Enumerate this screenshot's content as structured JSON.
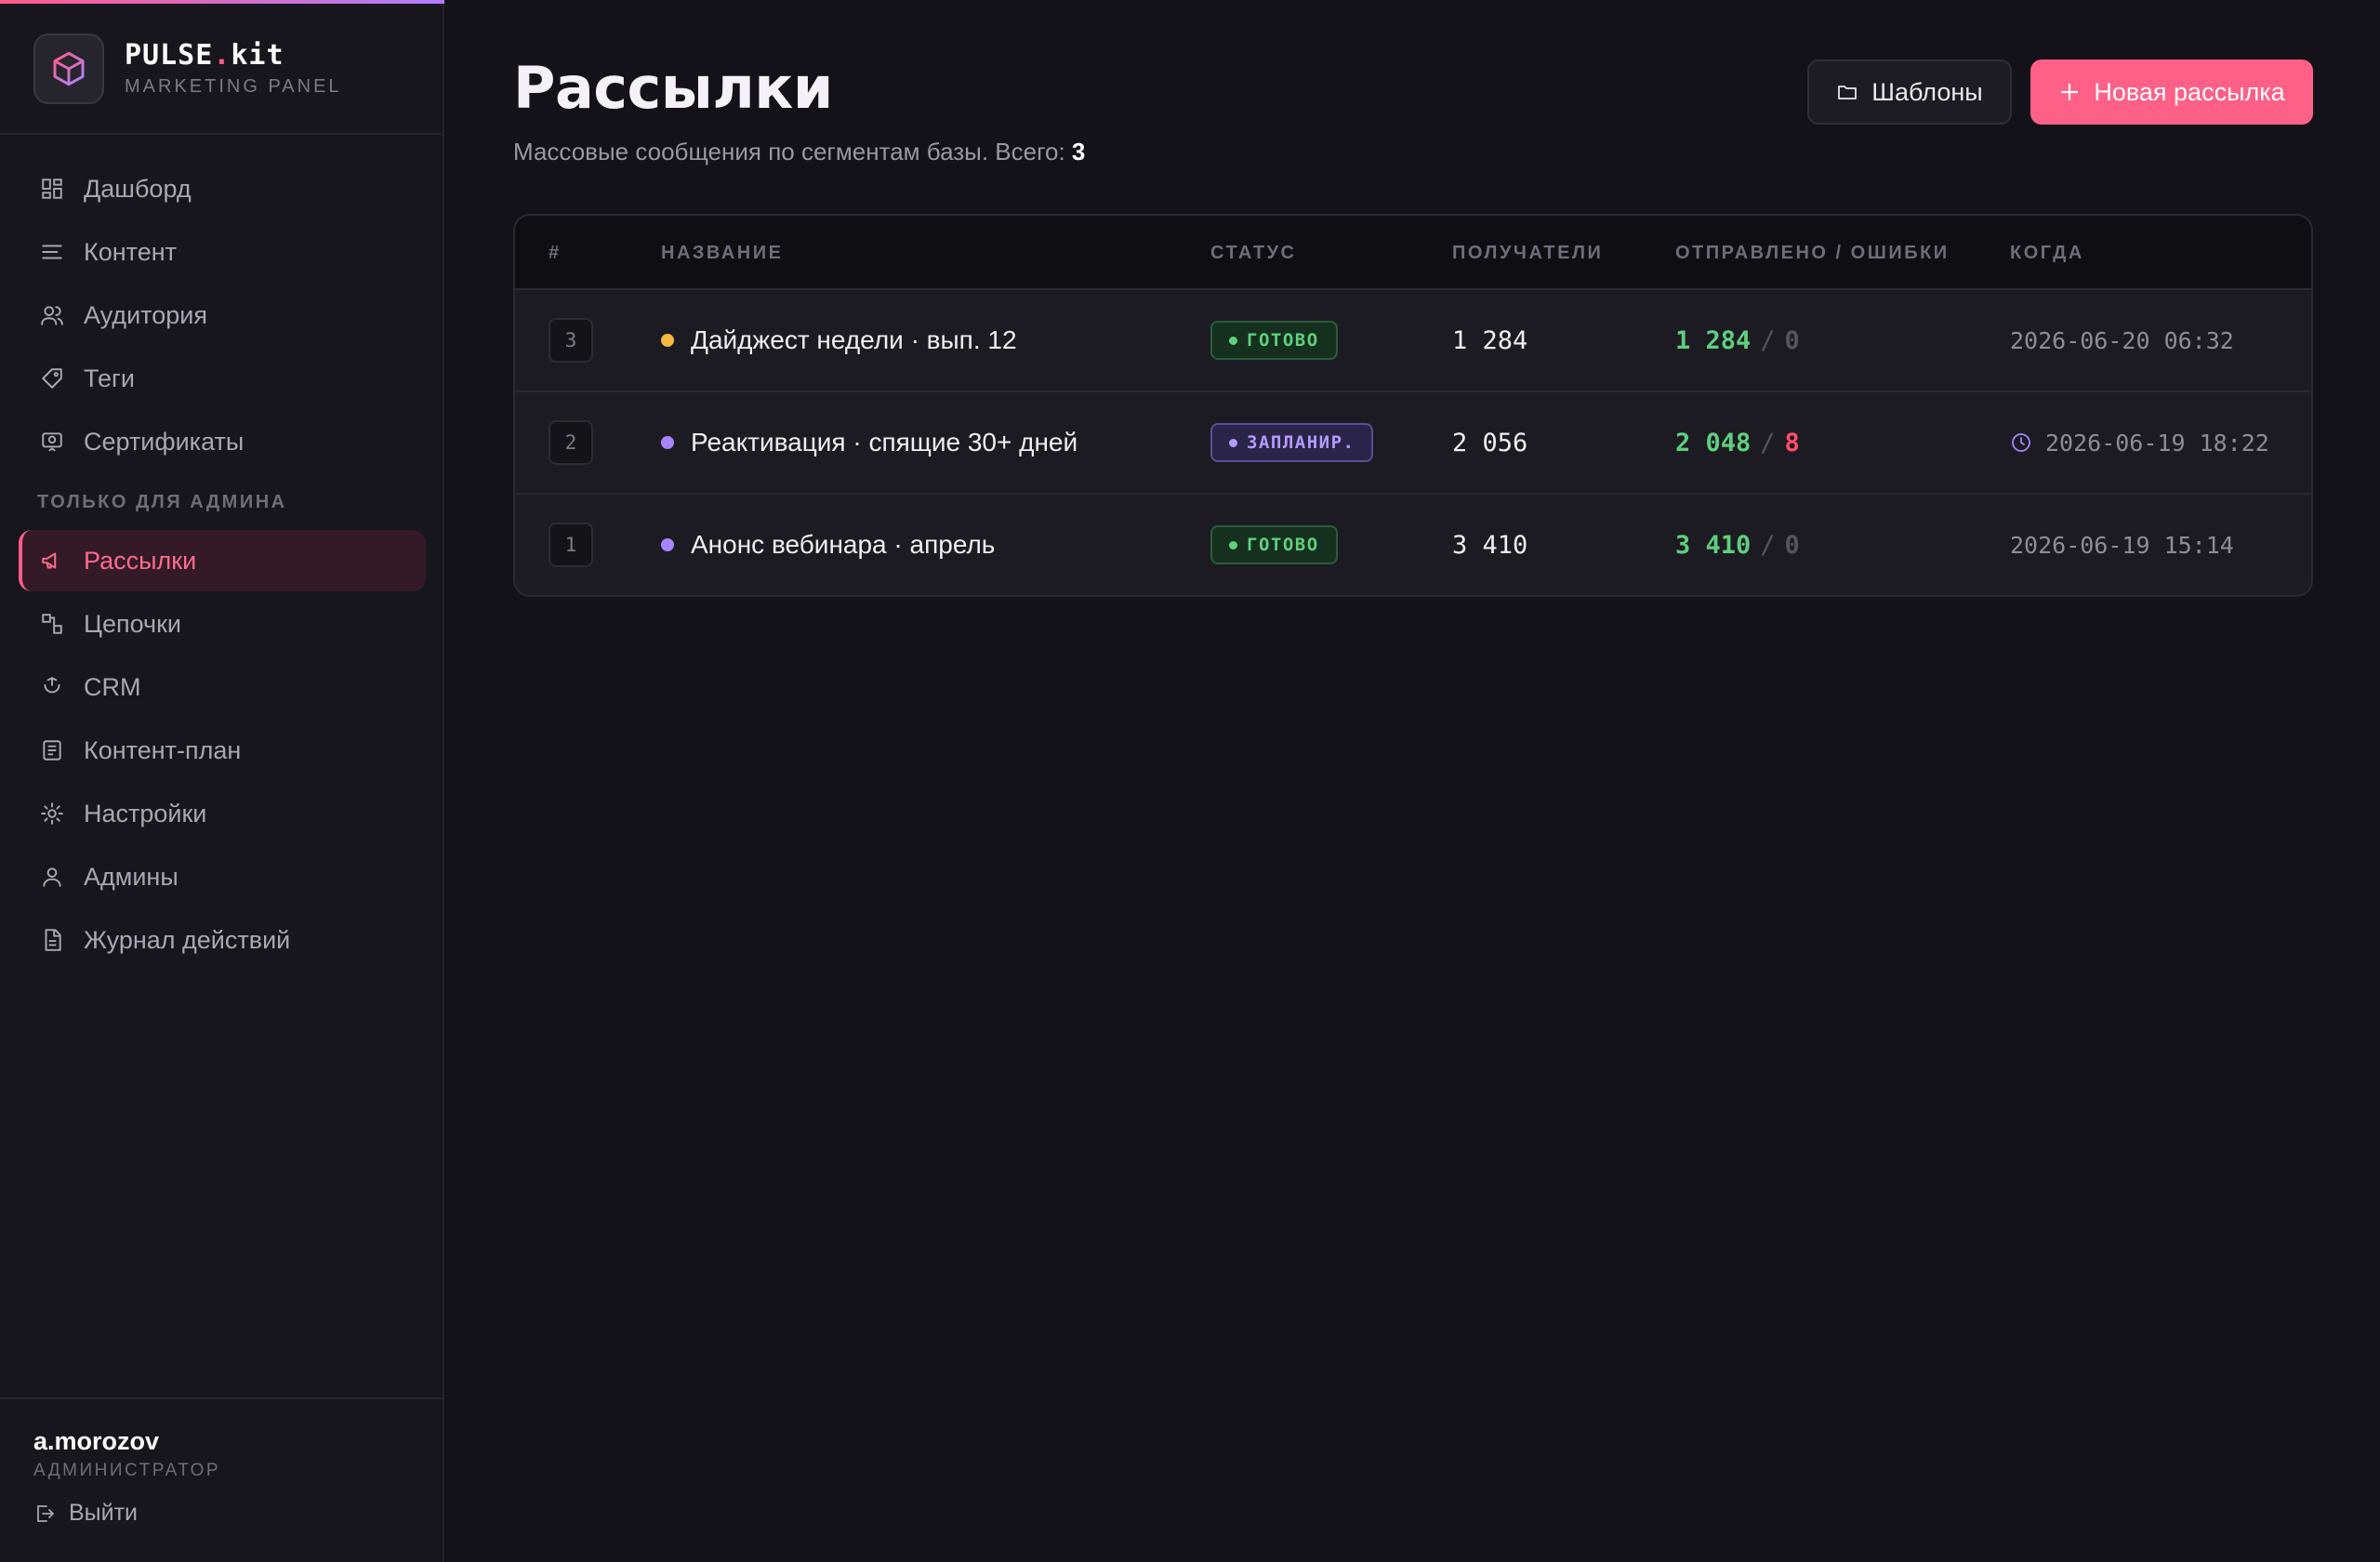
{
  "brand": {
    "name_main": "PULSE",
    "name_dot": ".",
    "name_suffix": "kit",
    "subtitle": "MARKETING PANEL",
    "accent_color": "#ff5c8a"
  },
  "nav": {
    "items": [
      {
        "label": "Дашборд",
        "icon": "dashboard-icon"
      },
      {
        "label": "Контент",
        "icon": "lines-icon"
      },
      {
        "label": "Аудитория",
        "icon": "users-icon"
      },
      {
        "label": "Теги",
        "icon": "tag-icon"
      },
      {
        "label": "Сертификаты",
        "icon": "certificate-icon"
      }
    ],
    "admin_section_label": "ТОЛЬКО ДЛЯ АДМИНА",
    "admin_items": [
      {
        "label": "Рассылки",
        "icon": "megaphone-icon",
        "active": true
      },
      {
        "label": "Цепочки",
        "icon": "chain-icon"
      },
      {
        "label": "CRM",
        "icon": "crm-icon"
      },
      {
        "label": "Контент-план",
        "icon": "document-icon"
      },
      {
        "label": "Настройки",
        "icon": "gear-icon"
      },
      {
        "label": "Админы",
        "icon": "user-icon"
      },
      {
        "label": "Журнал действий",
        "icon": "log-icon"
      }
    ]
  },
  "user": {
    "name": "a.morozov",
    "role": "АДМИНИСТРАТОР",
    "logout_label": "Выйти"
  },
  "header": {
    "title": "Рассылки",
    "subtitle_prefix": "Массовые сообщения по сегментам базы. Всего: ",
    "total": "3",
    "templates_label": "Шаблоны",
    "new_label": "Новая рассылка"
  },
  "table": {
    "columns": [
      "#",
      "НАЗВАНИЕ",
      "СТАТУС",
      "ПОЛУЧАТЕЛИ",
      "ОТПРАВЛЕНО / ОШИБКИ",
      "КОГДА"
    ],
    "rows": [
      {
        "idx": "3",
        "bullet_color": "#f5b942",
        "name": "Дайджест недели · вып. 12",
        "status": "ГОТОВО",
        "status_kind": "done",
        "recipients": "1 284",
        "sent": "1 284",
        "slash": "/",
        "errors": "0",
        "when": "2026-06-20 06:32",
        "scheduled": false
      },
      {
        "idx": "2",
        "bullet_color": "#a884ff",
        "name": "Реактивация · спящие 30+ дней",
        "status": "ЗАПЛАНИР.",
        "status_kind": "scheduled",
        "recipients": "2 056",
        "sent": "2 048",
        "slash": "/",
        "errors": "8",
        "when": "2026-06-19 18:22",
        "scheduled": true
      },
      {
        "idx": "1",
        "bullet_color": "#a884ff",
        "name": "Анонс вебинара · апрель",
        "status": "ГОТОВО",
        "status_kind": "done",
        "recipients": "3 410",
        "sent": "3 410",
        "slash": "/",
        "errors": "0",
        "when": "2026-06-19 15:14",
        "scheduled": false
      }
    ]
  }
}
